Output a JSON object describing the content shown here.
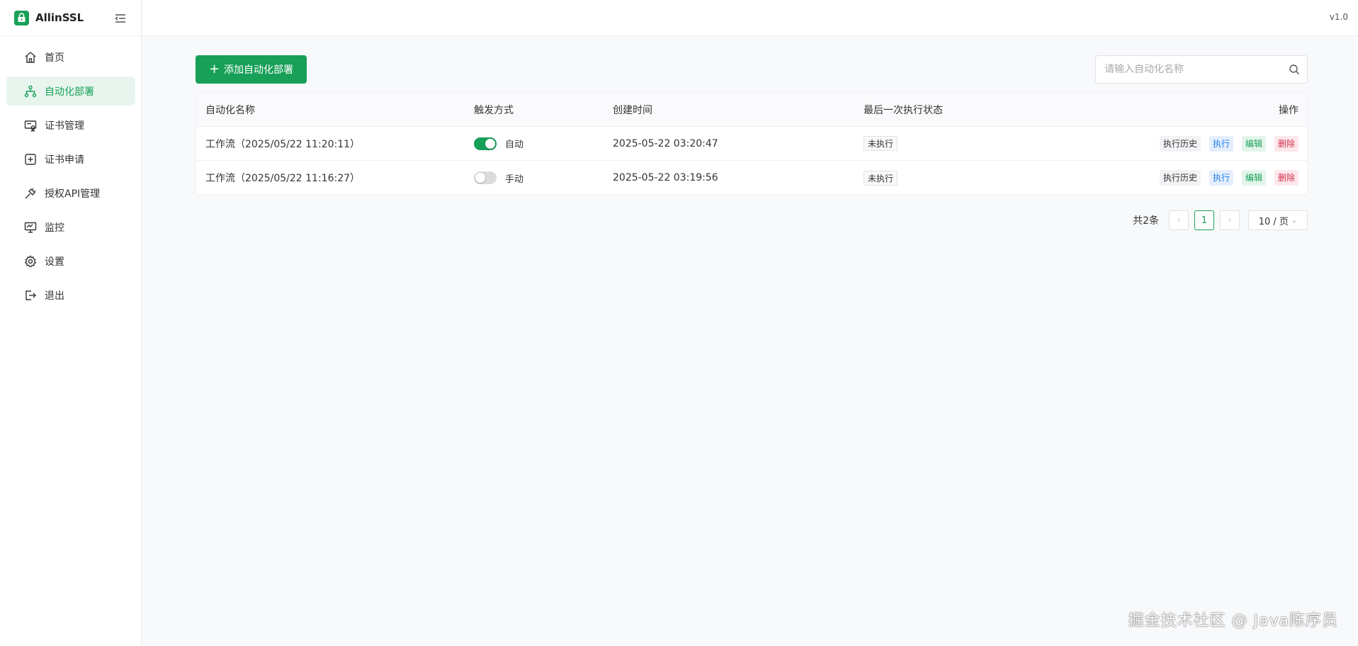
{
  "app": {
    "name": "AllinSSL",
    "version": "v1.0",
    "accent": "#18a058"
  },
  "sidebar": {
    "items": [
      {
        "label": "首页",
        "icon": "home-icon"
      },
      {
        "label": "自动化部署",
        "icon": "workflow-icon",
        "active": true
      },
      {
        "label": "证书管理",
        "icon": "certificate-icon"
      },
      {
        "label": "证书申请",
        "icon": "plus-square-icon"
      },
      {
        "label": "授权API管理",
        "icon": "api-plug-icon"
      },
      {
        "label": "监控",
        "icon": "monitor-icon"
      },
      {
        "label": "设置",
        "icon": "gear-icon"
      },
      {
        "label": "退出",
        "icon": "logout-icon"
      }
    ]
  },
  "toolbar": {
    "add_label": "添加自动化部署",
    "search_placeholder": "请输入自动化名称"
  },
  "table": {
    "headers": [
      "自动化名称",
      "触发方式",
      "创建时间",
      "最后一次执行状态",
      "操作"
    ],
    "rows": [
      {
        "name": "工作流（2025/05/22 11:20:11）",
        "trigger": "自动",
        "trigger_on": true,
        "created": "2025-05-22 03:20:47",
        "status": "未执行"
      },
      {
        "name": "工作流（2025/05/22 11:16:27）",
        "trigger": "手动",
        "trigger_on": false,
        "created": "2025-05-22 03:19:56",
        "status": "未执行"
      }
    ],
    "actions": {
      "history": "执行历史",
      "run": "执行",
      "edit": "编辑",
      "delete": "删除"
    }
  },
  "pagination": {
    "total": "共2条",
    "prev": "‹",
    "current": "1",
    "next": "›",
    "page_size": "10 / 页"
  },
  "watermark": "掘金技术社区 @ Java陈序员"
}
